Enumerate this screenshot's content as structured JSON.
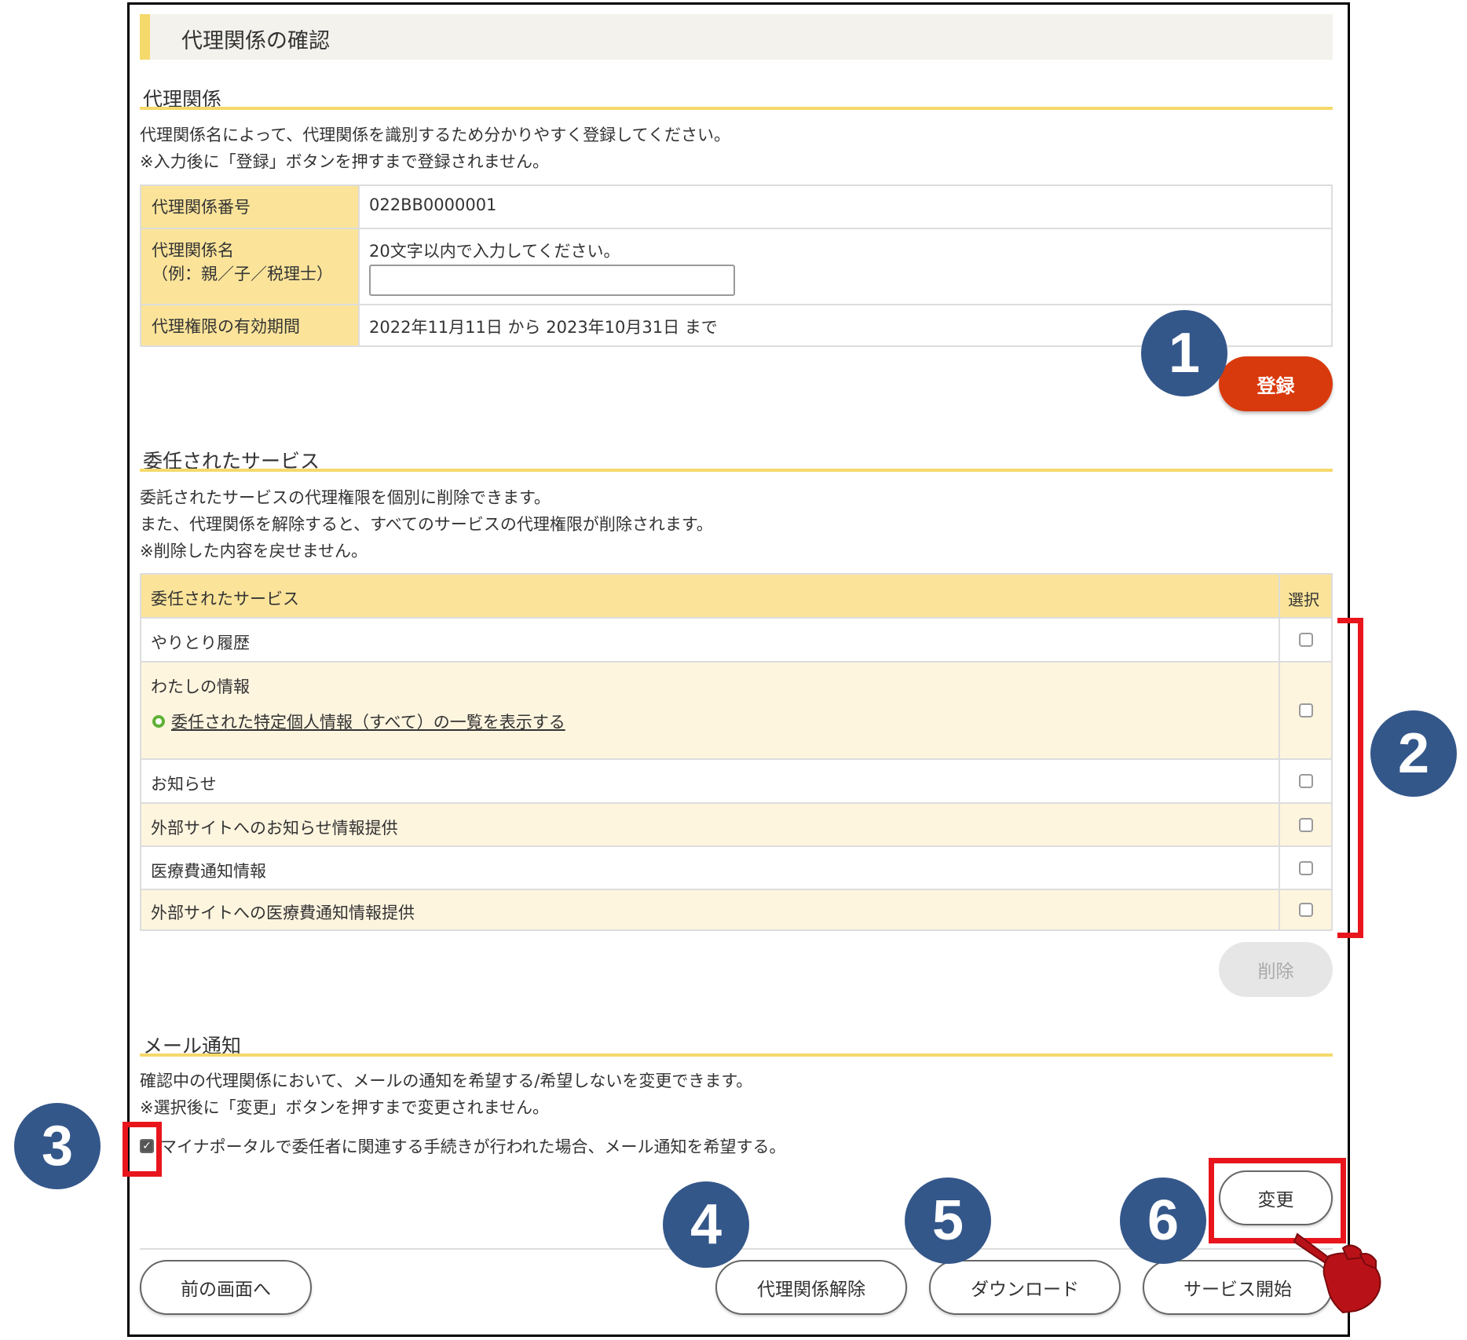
{
  "page_title": "代理関係の確認",
  "relationship": {
    "heading": "代理関係",
    "desc_lines": [
      "代理関係名によって、代理関係を識別するため分かりやすく登録してください。",
      "※入力後に「登録」ボタンを押すまで登録されません。"
    ],
    "rows": [
      {
        "label": "代理関係番号",
        "value": "022BB0000001"
      },
      {
        "label_line1": "代理関係名",
        "label_line2": "（例：親／子／税理士）",
        "hint": "20文字以内で入力してください。",
        "input_value": ""
      },
      {
        "label": "代理権限の有効期間",
        "value": "2022年11月11日 から 2023年10月31日 まで"
      }
    ],
    "register_button": "登録"
  },
  "services": {
    "heading": "委任されたサービス",
    "desc_lines": [
      "委託されたサービスの代理権限を個別に削除できます。",
      "また、代理関係を解除すると、すべてのサービスの代理権限が削除されます。",
      "※削除した内容を戻せません。"
    ],
    "table_header": {
      "name": "委任されたサービス",
      "select": "選択"
    },
    "items": [
      {
        "name": "やりとり履歴",
        "checked": false
      },
      {
        "name": "わたしの情報",
        "link": "委任された特定個人情報（すべて）の一覧を表示する",
        "checked": false
      },
      {
        "name": "お知らせ",
        "checked": false
      },
      {
        "name": "外部サイトへのお知らせ情報提供",
        "checked": false
      },
      {
        "name": "医療費通知情報",
        "checked": false
      },
      {
        "name": "外部サイトへの医療費通知情報提供",
        "checked": false
      }
    ],
    "delete_button": "削除"
  },
  "mail": {
    "heading": "メール通知",
    "desc_lines": [
      "確認中の代理関係において、メールの通知を希望する/希望しないを変更できます。",
      "※選択後に「変更」ボタンを押すまで変更されません。"
    ],
    "checkbox_label": "マイナポータルで委任者に関連する手続きが行われた場合、メール通知を希望する。",
    "checked": true,
    "change_button": "変更"
  },
  "footer": {
    "back_button": "前の画面へ",
    "dissolve_button": "代理関係解除",
    "download_button": "ダウンロード",
    "start_button": "サービス開始"
  },
  "markers": [
    "1",
    "2",
    "3",
    "4",
    "5",
    "6"
  ],
  "colors": {
    "accent_yellow": "#f5d96b",
    "header_yellow": "#fbe49a",
    "row_cream": "#fef5df",
    "register_red": "#d93a0d",
    "marker_blue": "#34578a",
    "highlight_red": "#e8161c",
    "link_green": "#5fb135"
  },
  "icons": {
    "link_bullet": "green-circle-icon",
    "pointer": "pointing-hand-icon"
  }
}
